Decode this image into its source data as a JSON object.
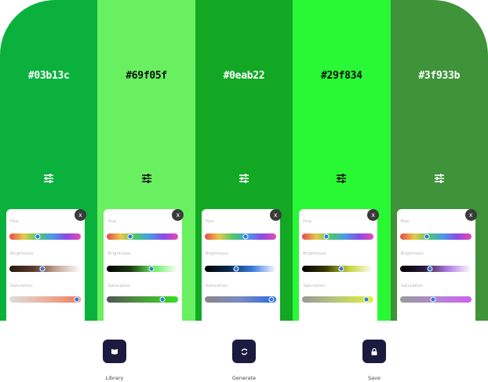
{
  "palette": [
    {
      "hex": "#03b13c",
      "bg": "#0ab13c",
      "text_color": "#ffffff",
      "icon_color": "#ffffff",
      "sliders": {
        "hue": {
          "label": "Hue",
          "value": 0.4
        },
        "brightness": {
          "label": "Brightness",
          "value": 0.46,
          "colors": [
            "#2a1a10",
            "#5a3a2a",
            "#c9a99a",
            "#ffffff"
          ]
        },
        "saturation": {
          "label": "Saturation",
          "value": 0.94,
          "colors": [
            "#dcdcdc",
            "#ebb0a0",
            "#f08060"
          ]
        }
      }
    },
    {
      "hex": "#69f05f",
      "bg": "#69f061",
      "text_color": "#111111",
      "icon_color": "#111111",
      "sliders": {
        "hue": {
          "label": "Hue",
          "value": 0.32
        },
        "brightness": {
          "label": "Brightness",
          "value": 0.62,
          "colors": [
            "#000000",
            "#1a3a10",
            "#69f05f",
            "#ffffff"
          ]
        },
        "saturation": {
          "label": "Saturation",
          "value": 0.78,
          "colors": [
            "#555555",
            "#4a9a3a",
            "#33e022"
          ]
        }
      }
    },
    {
      "hex": "#0eab22",
      "bg": "#12a824",
      "text_color": "#ffffff",
      "icon_color": "#ffffff",
      "sliders": {
        "hue": {
          "label": "Hue",
          "value": 0.57
        },
        "brightness": {
          "label": "Brightness",
          "value": 0.44,
          "colors": [
            "#000000",
            "#0a2a4a",
            "#3a7ae0",
            "#ffffff"
          ]
        },
        "saturation": {
          "label": "Saturation",
          "value": 0.94,
          "colors": [
            "#888888",
            "#7a8ac0",
            "#2a6ae8"
          ]
        }
      }
    },
    {
      "hex": "#29f834",
      "bg": "#29f834",
      "text_color": "#111111",
      "icon_color": "#111111",
      "sliders": {
        "hue": {
          "label": "Hue",
          "value": 0.34
        },
        "brightness": {
          "label": "Brightness",
          "value": 0.55,
          "colors": [
            "#000000",
            "#3a3a00",
            "#c8d640",
            "#ffffff"
          ]
        },
        "saturation": {
          "label": "Saturation",
          "value": 0.9,
          "colors": [
            "#999999",
            "#b8c878",
            "#e2f03a"
          ]
        }
      }
    },
    {
      "hex": "#3f933b",
      "bg": "#3f9339",
      "text_color": "#ffffff",
      "icon_color": "#ffffff",
      "sliders": {
        "hue": {
          "label": "Hue",
          "value": 0.38
        },
        "brightness": {
          "label": "Brightness",
          "value": 0.42,
          "colors": [
            "#000000",
            "#2a1a3a",
            "#b07ae0",
            "#ffffff"
          ]
        },
        "saturation": {
          "label": "Saturation",
          "value": 0.47,
          "colors": [
            "#999999",
            "#b089d0",
            "#d060f0"
          ]
        }
      }
    }
  ],
  "hue_gradient": [
    "#e84a4a",
    "#e8c84a",
    "#4ac86a",
    "#4a9ae8",
    "#8a4ae8",
    "#e84ab0"
  ],
  "close_label": "x",
  "bottom_nav": [
    {
      "label": "Library",
      "icon": "book-icon"
    },
    {
      "label": "Generate",
      "icon": "refresh-icon"
    },
    {
      "label": "Save",
      "icon": "lock-icon"
    }
  ],
  "accent": "#1b1b3f"
}
